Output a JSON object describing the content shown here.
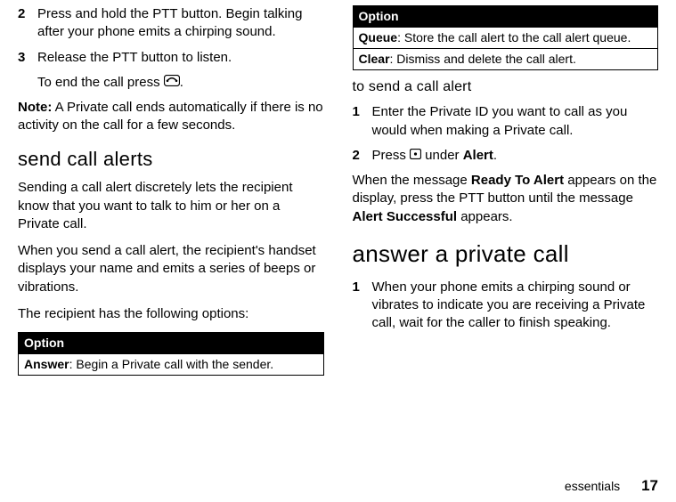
{
  "left": {
    "step2_num": "2",
    "step2_body": "Press and hold the PTT button. Begin talking after your phone emits a chirping sound.",
    "step3_num": "3",
    "step3_body": "Release the PTT button to listen.",
    "end_call_pre": "To end the call press ",
    "end_call_post": ".",
    "note_label": "Note:",
    "note_body": " A Private call ends automatically if there is no activity on the call for a few seconds.",
    "h_send_alerts": "send call alerts",
    "p1": "Sending a call alert discretely lets the recipient know that you want to talk to him or her on a Private call.",
    "p2": "When you send a call alert, the recipient's handset displays your name and emits a series of beeps or vibrations.",
    "p3": "The recipient has the following options:",
    "tbl_header": "Option",
    "tbl_row1_label": "Answer",
    "tbl_row1_rest": ": Begin a Private call with the sender."
  },
  "right": {
    "tbl_header": "Option",
    "tbl_row1_label": "Queue",
    "tbl_row1_rest": ": Store the call alert to the call alert queue.",
    "tbl_row2_label": "Clear",
    "tbl_row2_rest": ": Dismiss and delete the call alert.",
    "subh": "to send a call alert",
    "step1_num": "1",
    "step1_body": "Enter the Private ID you want to call as you would when making a Private call.",
    "step2_num": "2",
    "step2_pre": "Press ",
    "step2_mid": " under ",
    "step2_alert": "Alert",
    "step2_post": ".",
    "ready_pre": "When the message ",
    "ready_label": "Ready To Alert",
    "ready_mid": " appears on the display, press the PTT button until the message ",
    "success_label": "Alert Successful",
    "ready_post": " appears.",
    "h_answer": "answer a private call",
    "ans_step1_num": "1",
    "ans_step1_body": "When your phone emits a chirping sound or vibrates to indicate you are receiving a Private call, wait for the caller to finish speaking."
  },
  "footer": {
    "section": "essentials",
    "page": "17"
  }
}
